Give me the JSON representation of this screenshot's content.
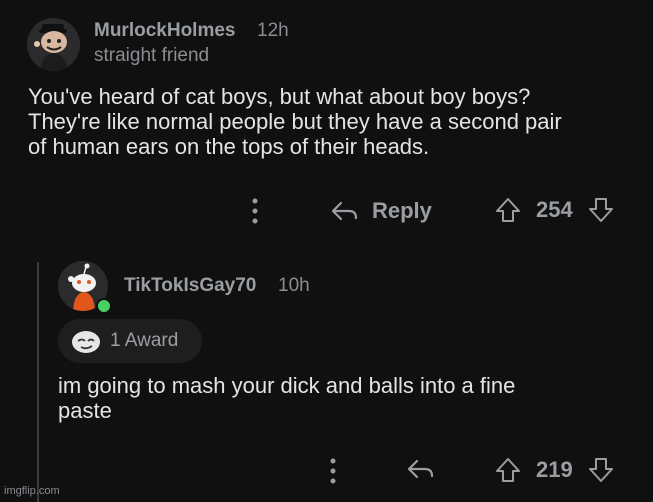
{
  "comment1": {
    "username": "MurlockHolmes",
    "time": "12h",
    "flair": "straight friend",
    "body_lines": [
      "You've heard of cat boys, but what about boy boys?",
      "They're like normal people but they have a second pair",
      "of human ears on the tops of their heads."
    ],
    "reply_label": "Reply",
    "score": "254"
  },
  "comment2": {
    "username": "TikTokIsGay70",
    "time": "10h",
    "award_label": "1 Award",
    "body_lines": [
      "im going to mash your dick and balls into a fine",
      "paste"
    ],
    "score": "219"
  },
  "watermark": "imgflip.com",
  "colors": {
    "background": "#101010",
    "text": "#e2e4e6",
    "muted": "#9a9ea2",
    "online": "#46d160",
    "avatar_orange": "#e0561d"
  },
  "icons": [
    "more-dots-icon",
    "reply-arrow-icon",
    "upvote-icon",
    "downvote-icon",
    "award-icon"
  ]
}
